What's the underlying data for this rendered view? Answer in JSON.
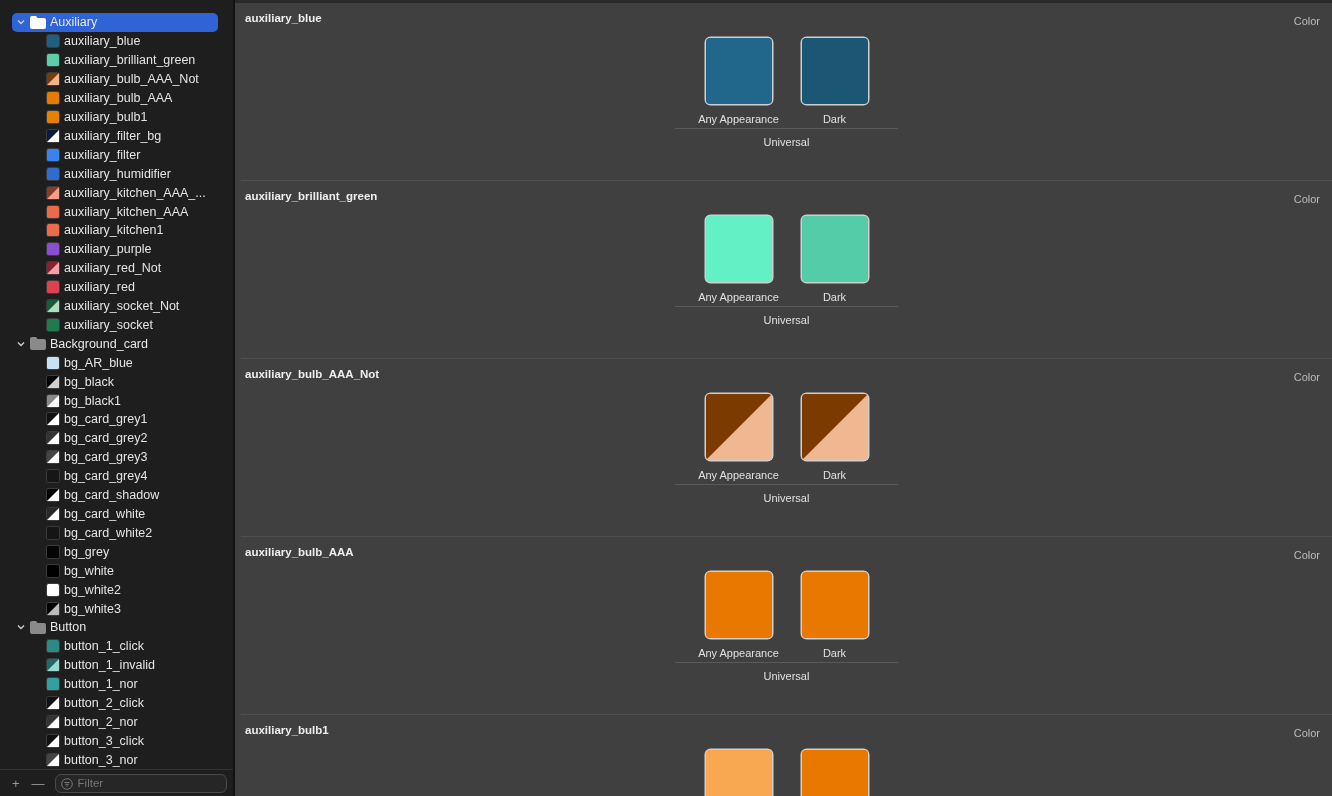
{
  "sidebar": {
    "tree": [
      {
        "name": "Auxiliary",
        "expanded": true,
        "selected": true,
        "children": [
          {
            "name": "auxiliary_blue",
            "swatch": [
              {
                "color": "#1f5f7f"
              }
            ]
          },
          {
            "name": "auxiliary_brilliant_green",
            "swatch": [
              {
                "color": "#5ccfa8"
              }
            ]
          },
          {
            "name": "auxiliary_bulb_AAA_Not",
            "swatch": [
              {
                "color": "#7a3b0a"
              },
              {
                "color": "#f0b48c"
              }
            ]
          },
          {
            "name": "auxiliary_bulb_AAA",
            "swatch": [
              {
                "color": "#e87a00"
              }
            ]
          },
          {
            "name": "auxiliary_bulb1",
            "swatch": [
              {
                "color": "#e88000"
              }
            ]
          },
          {
            "name": "auxiliary_filter_bg",
            "swatch": [
              {
                "color": "#0a1a40"
              },
              {
                "color": "#ffffff"
              }
            ]
          },
          {
            "name": "auxiliary_filter",
            "swatch": [
              {
                "color": "#3a82f0"
              }
            ]
          },
          {
            "name": "auxiliary_humidifier",
            "swatch": [
              {
                "color": "#2f6bd0"
              }
            ]
          },
          {
            "name": "auxiliary_kitchen_AAA_...",
            "swatch": [
              {
                "color": "#8a3a2a"
              },
              {
                "color": "#f2a08c"
              }
            ]
          },
          {
            "name": "auxiliary_kitchen_AAA",
            "swatch": [
              {
                "color": "#ea6a4a"
              }
            ]
          },
          {
            "name": "auxiliary_kitchen1",
            "swatch": [
              {
                "color": "#ec6b4b"
              }
            ]
          },
          {
            "name": "auxiliary_purple",
            "swatch": [
              {
                "color": "#8a4fd0"
              }
            ]
          },
          {
            "name": "auxiliary_red_Not",
            "swatch": [
              {
                "color": "#8a2030"
              },
              {
                "color": "#f2a0a8"
              }
            ]
          },
          {
            "name": "auxiliary_red",
            "swatch": [
              {
                "color": "#e04050"
              }
            ]
          },
          {
            "name": "auxiliary_socket_Not",
            "swatch": [
              {
                "color": "#1a5a3a"
              },
              {
                "color": "#b0dcc0"
              }
            ]
          },
          {
            "name": "auxiliary_socket",
            "swatch": [
              {
                "color": "#1f7a50"
              }
            ]
          }
        ]
      },
      {
        "name": "Background_card",
        "expanded": true,
        "selected": false,
        "children": [
          {
            "name": "bg_AR_blue",
            "swatch": [
              {
                "color": "#c8e0f4"
              }
            ]
          },
          {
            "name": "bg_black",
            "swatch": [
              {
                "color": "#000000"
              },
              {
                "color": "#d0d0d0"
              }
            ]
          },
          {
            "name": "bg_black1",
            "swatch": [
              {
                "color": "#888888"
              },
              {
                "color": "#ffffff"
              }
            ]
          },
          {
            "name": "bg_card_grey1",
            "swatch": [
              {
                "color": "#111111"
              },
              {
                "color": "#ffffff"
              }
            ]
          },
          {
            "name": "bg_card_grey2",
            "swatch": [
              {
                "color": "#333333"
              },
              {
                "color": "#ffffff"
              }
            ]
          },
          {
            "name": "bg_card_grey3",
            "swatch": [
              {
                "color": "#444444"
              },
              {
                "color": "#ffffff"
              }
            ]
          },
          {
            "name": "bg_card_grey4",
            "swatch": [
              {
                "color": "#161616"
              }
            ]
          },
          {
            "name": "bg_card_shadow",
            "swatch": [
              {
                "color": "#000000"
              },
              {
                "color": "#ffffff"
              }
            ]
          },
          {
            "name": "bg_card_white",
            "swatch": [
              {
                "color": "#282828"
              },
              {
                "color": "#ffffff"
              }
            ]
          },
          {
            "name": "bg_card_white2",
            "swatch": [
              {
                "color": "#151515"
              }
            ]
          },
          {
            "name": "bg_grey",
            "swatch": [
              {
                "color": "#050505"
              }
            ]
          },
          {
            "name": "bg_white",
            "swatch": [
              {
                "color": "#000000"
              }
            ]
          },
          {
            "name": "bg_white2",
            "swatch": [
              {
                "color": "#ffffff"
              }
            ]
          },
          {
            "name": "bg_white3",
            "swatch": [
              {
                "color": "#000000"
              },
              {
                "color": "#bbbbbb"
              }
            ]
          }
        ]
      },
      {
        "name": "Button",
        "expanded": true,
        "selected": false,
        "children": [
          {
            "name": "button_1_click",
            "swatch": [
              {
                "color": "#2a8a86"
              }
            ]
          },
          {
            "name": "button_1_invalid",
            "swatch": [
              {
                "color": "#1e6a66"
              },
              {
                "color": "#9ad8d0"
              }
            ]
          },
          {
            "name": "button_1_nor",
            "swatch": [
              {
                "color": "#30a0a0"
              }
            ]
          },
          {
            "name": "button_2_click",
            "swatch": [
              {
                "color": "#111111"
              },
              {
                "color": "#ffffff"
              }
            ]
          },
          {
            "name": "button_2_nor",
            "swatch": [
              {
                "color": "#333333"
              },
              {
                "color": "#ffffff"
              }
            ]
          },
          {
            "name": "button_3_click",
            "swatch": [
              {
                "color": "#111111"
              },
              {
                "color": "#ffffff"
              }
            ]
          },
          {
            "name": "button_3_nor",
            "swatch": [
              {
                "color": "#444444"
              },
              {
                "color": "#ffffff"
              }
            ]
          }
        ]
      }
    ],
    "add_button": "+",
    "remove_button": "—",
    "filter": {
      "placeholder": "Filter"
    }
  },
  "sections": [
    {
      "name": "auxiliary_blue",
      "type": "Color",
      "appearances": [
        {
          "label": "Any Appearance",
          "fill": [
            {
              "color": "#21678c"
            }
          ]
        },
        {
          "label": "Dark",
          "fill": [
            {
              "color": "#1b5675"
            }
          ]
        }
      ],
      "device": "Universal"
    },
    {
      "name": "auxiliary_brilliant_green",
      "type": "Color",
      "appearances": [
        {
          "label": "Any Appearance",
          "fill": [
            {
              "color": "#62f0c4"
            }
          ]
        },
        {
          "label": "Dark",
          "fill": [
            {
              "color": "#55cca8"
            }
          ]
        }
      ],
      "device": "Universal"
    },
    {
      "name": "auxiliary_bulb_AAA_Not",
      "type": "Color",
      "appearances": [
        {
          "label": "Any Appearance",
          "fill": [
            {
              "color": "#7a3a00"
            },
            {
              "color": "#f0b890"
            }
          ]
        },
        {
          "label": "Dark",
          "fill": [
            {
              "color": "#7a3a00"
            },
            {
              "color": "#f0b890"
            }
          ]
        }
      ],
      "device": "Universal"
    },
    {
      "name": "auxiliary_bulb_AAA",
      "type": "Color",
      "appearances": [
        {
          "label": "Any Appearance",
          "fill": [
            {
              "color": "#e87800"
            }
          ]
        },
        {
          "label": "Dark",
          "fill": [
            {
              "color": "#e87800"
            }
          ]
        }
      ],
      "device": "Universal"
    },
    {
      "name": "auxiliary_bulb1",
      "type": "Color",
      "appearances": [
        {
          "fill": [
            {
              "color": "#f8a850"
            }
          ]
        },
        {
          "fill": [
            {
              "color": "#e87800"
            }
          ]
        }
      ]
    }
  ]
}
